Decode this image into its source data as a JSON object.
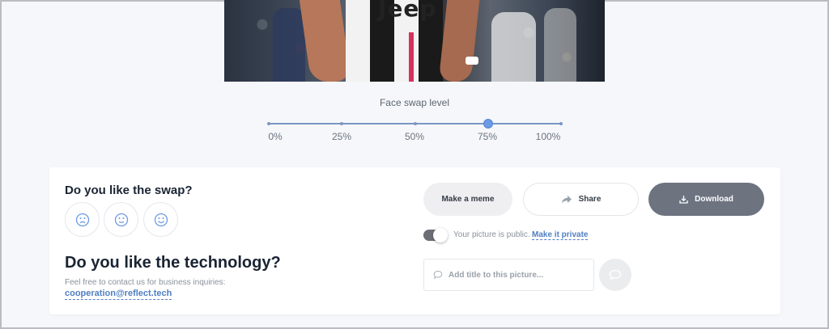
{
  "photo": {
    "brand_text": "Jeep"
  },
  "slider": {
    "title": "Face swap level",
    "labels": [
      "0%",
      "25%",
      "50%",
      "75%",
      "100%"
    ],
    "value_percent": 75,
    "track_color": "#7a96c4",
    "thumb_color": "#6b9ae6"
  },
  "feedback": {
    "question": "Do you like the swap?",
    "emojis": [
      "sad-face-icon",
      "neutral-face-icon",
      "happy-face-icon"
    ]
  },
  "technology": {
    "heading": "Do you like the technology?",
    "hint": "Feel free to contact us for business inquiries:",
    "email": "cooperation@reflect.tech"
  },
  "actions": {
    "meme_label": "Make a meme",
    "share_label": "Share",
    "download_label": "Download",
    "download_color": "#6e7380"
  },
  "privacy": {
    "status_text": "Your picture is public.",
    "link_text": "Make it private"
  },
  "title_input": {
    "placeholder": "Add title to this picture..."
  },
  "colors": {
    "link": "#4f7fc2",
    "background": "#f6f7fa"
  }
}
